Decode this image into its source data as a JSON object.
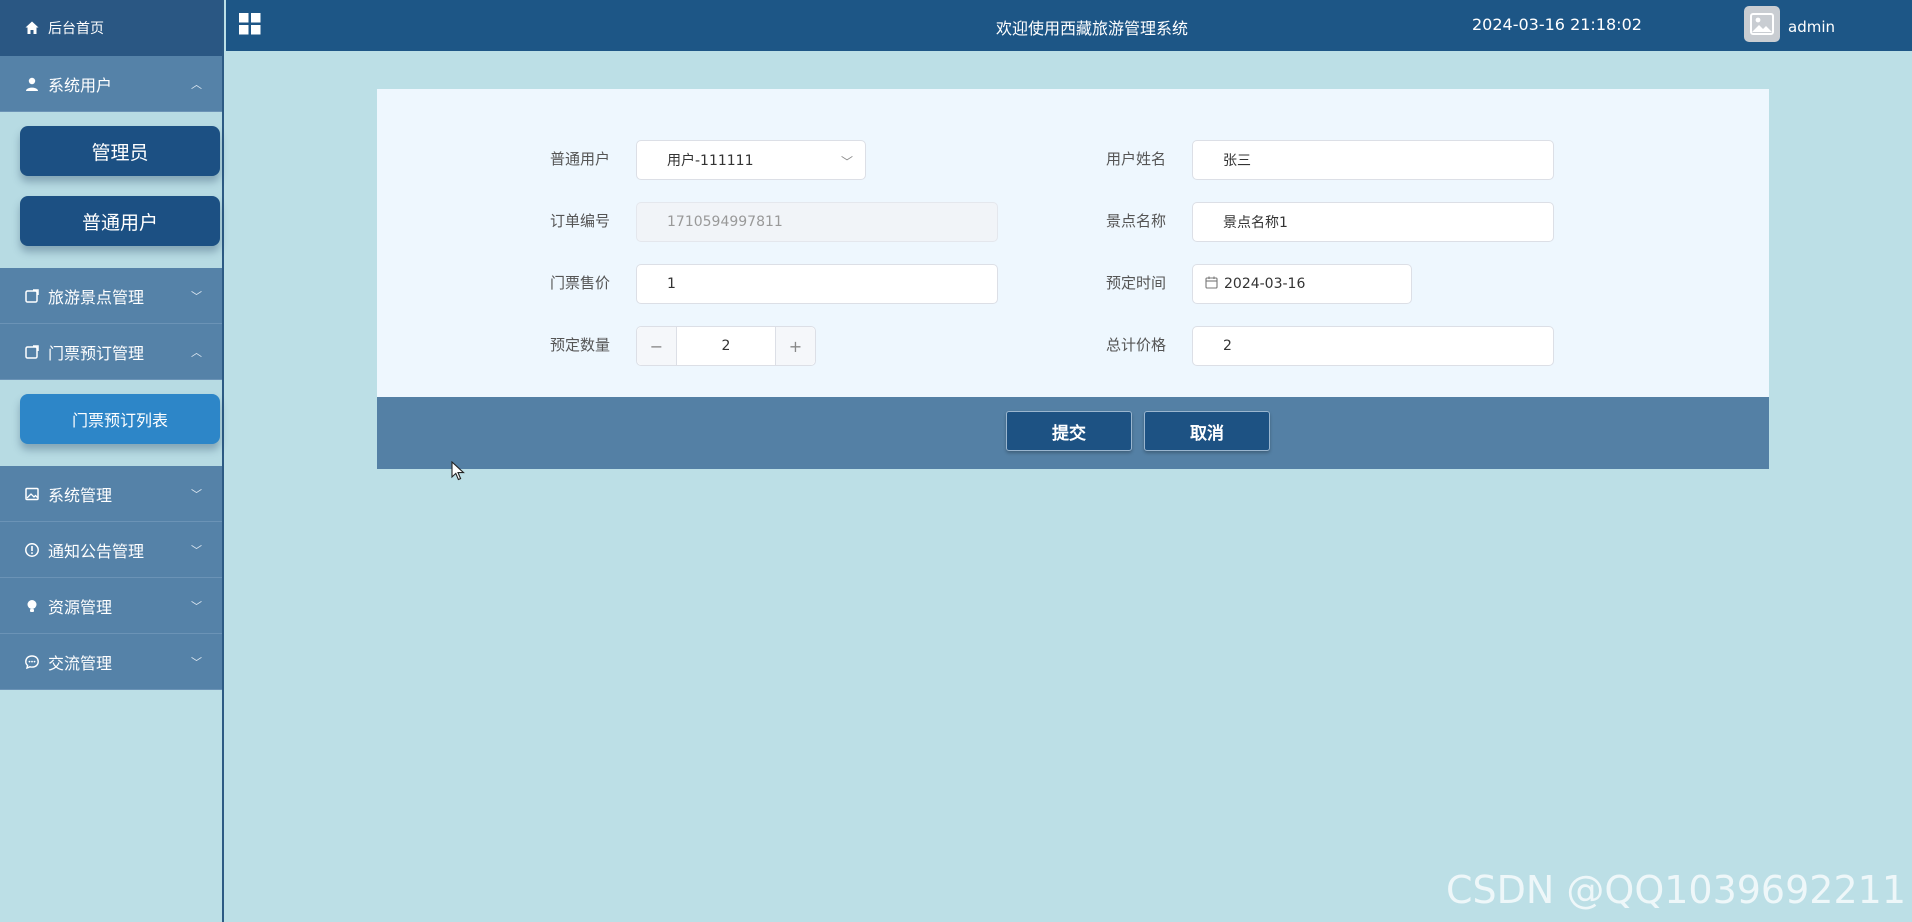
{
  "sidebar": {
    "home_label": "后台首页",
    "menus": [
      {
        "label": "系统用户",
        "icon": "user-icon",
        "expanded": true,
        "subitems": [
          {
            "label": "管理员"
          },
          {
            "label": "普通用户"
          }
        ]
      },
      {
        "label": "旅游景点管理",
        "icon": "edit-icon",
        "expanded": false
      },
      {
        "label": "门票预订管理",
        "icon": "edit-icon",
        "expanded": true,
        "subitems": [
          {
            "label": "门票预订列表"
          }
        ]
      },
      {
        "label": "系统管理",
        "icon": "image-icon",
        "expanded": false
      },
      {
        "label": "通知公告管理",
        "icon": "info-icon",
        "expanded": false
      },
      {
        "label": "资源管理",
        "icon": "bulb-icon",
        "expanded": false
      },
      {
        "label": "交流管理",
        "icon": "chat-icon",
        "expanded": false
      }
    ]
  },
  "header": {
    "title": "欢迎使用西藏旅游管理系统",
    "datetime": "2024-03-16 21:18:02",
    "username": "admin"
  },
  "form": {
    "user_label": "普通用户",
    "user_value": "用户-111111",
    "name_label": "用户姓名",
    "name_value": "张三",
    "order_no_label": "订单编号",
    "order_no_value": "1710594997811",
    "spot_label": "景点名称",
    "spot_value": "景点名称1",
    "price_label": "门票售价",
    "price_value": "1",
    "date_label": "预定时间",
    "date_value": "2024-03-16",
    "qty_label": "预定数量",
    "qty_value": "2",
    "total_label": "总计价格",
    "total_value": "2"
  },
  "actions": {
    "submit_label": "提交",
    "cancel_label": "取消"
  },
  "watermark": "CSDN @QQ1039692211"
}
